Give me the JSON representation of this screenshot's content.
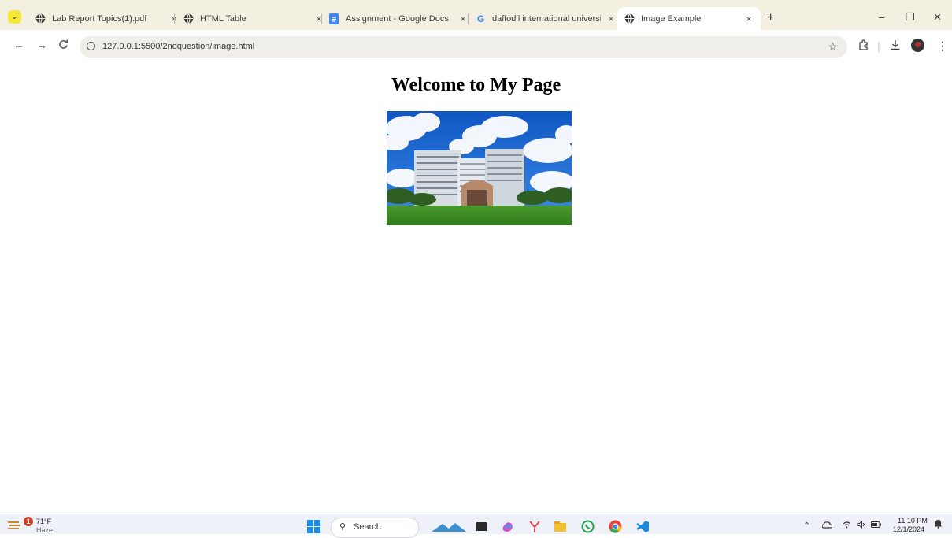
{
  "browser": {
    "tabs": [
      {
        "title": "Lab Report Topics(1).pdf",
        "icon": "globe-icon",
        "active": false
      },
      {
        "title": "HTML Table",
        "icon": "globe-icon",
        "active": false
      },
      {
        "title": "Assignment - Google Docs",
        "icon": "google-docs-icon",
        "active": false
      },
      {
        "title": "daffodil international university",
        "icon": "google-icon",
        "active": false
      },
      {
        "title": "Image Example",
        "icon": "globe-icon",
        "active": true
      }
    ],
    "close_glyph": "×",
    "new_tab_glyph": "+",
    "window_controls": {
      "minimize": "–",
      "restore": "❐",
      "close": "✕"
    },
    "address": {
      "url": "127.0.0.1:5500/2ndquestion/image.html"
    }
  },
  "page": {
    "heading": "Welcome to My Page",
    "image": {
      "alt": "Daffodil International University campus building"
    }
  },
  "taskbar": {
    "weather": {
      "temp": "71°F",
      "condition": "Haze",
      "badge": "1"
    },
    "search_label": "Search",
    "clock": {
      "time": "11:10 PM",
      "date": "12/1/2024"
    }
  },
  "colors": {
    "tab_strip_bg": "#f3f0e2",
    "omnibox_bg": "#efeee9",
    "taskbar_bg": "#eef1f8",
    "tab_search_button": "#f5e63a"
  }
}
